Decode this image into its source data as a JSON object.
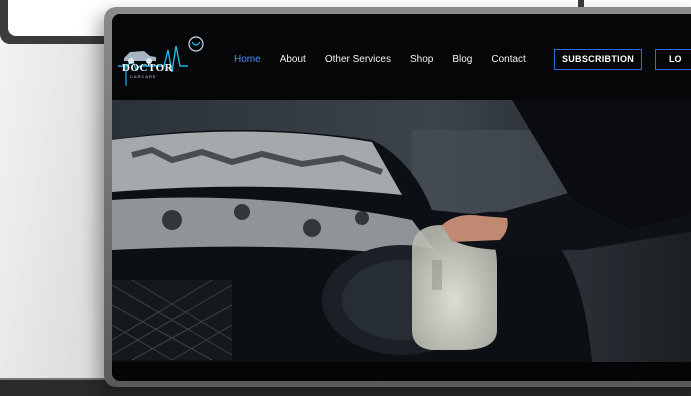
{
  "brand": {
    "name": "DOCTOR",
    "tagline": "CARCARE"
  },
  "nav": {
    "items": [
      {
        "label": "Home",
        "active": true
      },
      {
        "label": "About",
        "active": false
      },
      {
        "label": "Other Services",
        "active": false
      },
      {
        "label": "Shop",
        "active": false
      },
      {
        "label": "Blog",
        "active": false
      },
      {
        "label": "Contact",
        "active": false
      }
    ],
    "subscribe_label": "SUBSCRIBTION",
    "login_label": "LO"
  },
  "hero": {
    "image": "car-wash-foam-photo"
  },
  "colors": {
    "accent": "#2f6fd8",
    "active_link": "#4f8cff",
    "logo_line": "#1fb6e8",
    "background": "#050607"
  }
}
